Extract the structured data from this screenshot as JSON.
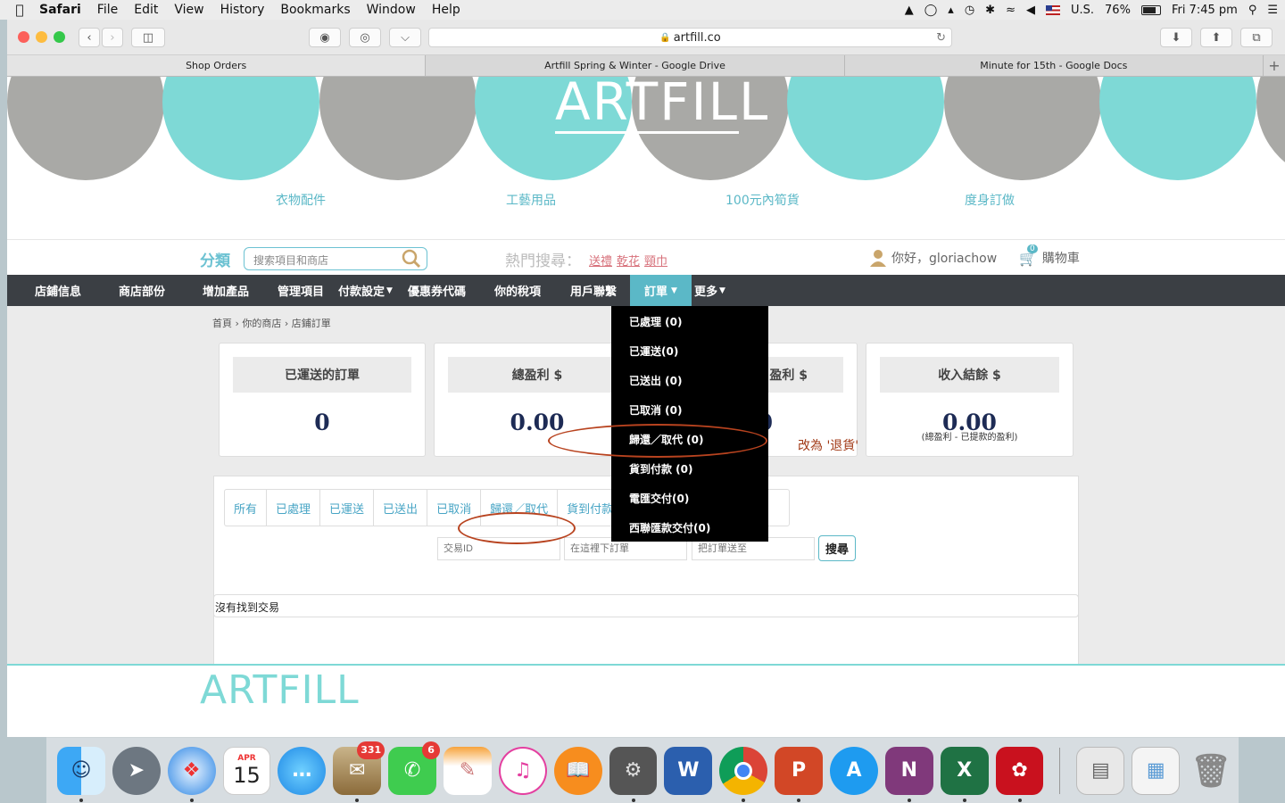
{
  "menubar": {
    "app": "Safari",
    "items": [
      "File",
      "Edit",
      "View",
      "History",
      "Bookmarks",
      "Window",
      "Help"
    ],
    "input_source": "U.S.",
    "battery": "76%",
    "clock": "Fri 7:45 pm"
  },
  "browser": {
    "url": "artfill.co",
    "tabs": [
      "Shop Orders",
      "Artfill Spring & Winter - Google Drive",
      "Minute for 15th - Google Docs"
    ],
    "active_tab": 0
  },
  "site": {
    "logo": "ARTFILL",
    "categories": [
      "衣物配件",
      "工藝用品",
      "100元內筍貨",
      "度身訂做"
    ],
    "search": {
      "title": "分類",
      "placeholder": "搜索項目和商店",
      "hot_label": "熱門搜尋：",
      "hot_links": [
        "送禮",
        "乾花",
        "頸巾"
      ]
    },
    "greeting": "你好，gloriachow",
    "cart_label": "購物車",
    "cart_count": "0",
    "nav": [
      "店鋪信息",
      "商店部份",
      "增加產品",
      "管理項目",
      "付款設定",
      "優惠券代碼",
      "你的稅項",
      "用戶聯繫",
      "訂單",
      "更多"
    ],
    "breadcrumb": "首頁 › 你的商店 › 店鋪訂單"
  },
  "cards": [
    {
      "title": "已運送的訂單",
      "value": "0"
    },
    {
      "title": "總盈利 $",
      "value": "0.00"
    },
    {
      "title": "盈利 $",
      "value": "0"
    },
    {
      "title": "收入結餘 $",
      "value": "0.00",
      "sub": "(總盈利 - 已提款的盈利)"
    }
  ],
  "filter_tabs": [
    "所有",
    "已處理",
    "已運送",
    "已送出",
    "已取消",
    "歸還／取代",
    "貨到付款"
  ],
  "filters": {
    "txn_placeholder": "交易ID",
    "date_placeholder": "在這裡下訂單",
    "ship_placeholder": "把訂單送至",
    "search_button": "搜尋"
  },
  "no_results": "沒有找到交易",
  "dropdown": [
    "已處理 (0)",
    "已運送(0)",
    "已送出 (0)",
    "已取消 (0)",
    "歸還／取代 (0)",
    "貨到付款 (0)",
    "電匯交付(0)",
    "西聯匯款交付(0)"
  ],
  "annotation": "改為 '退貨'",
  "dock": {
    "calendar_month": "APR",
    "calendar_day": "15",
    "mail_badge": "331",
    "facetime_badge": "6"
  }
}
